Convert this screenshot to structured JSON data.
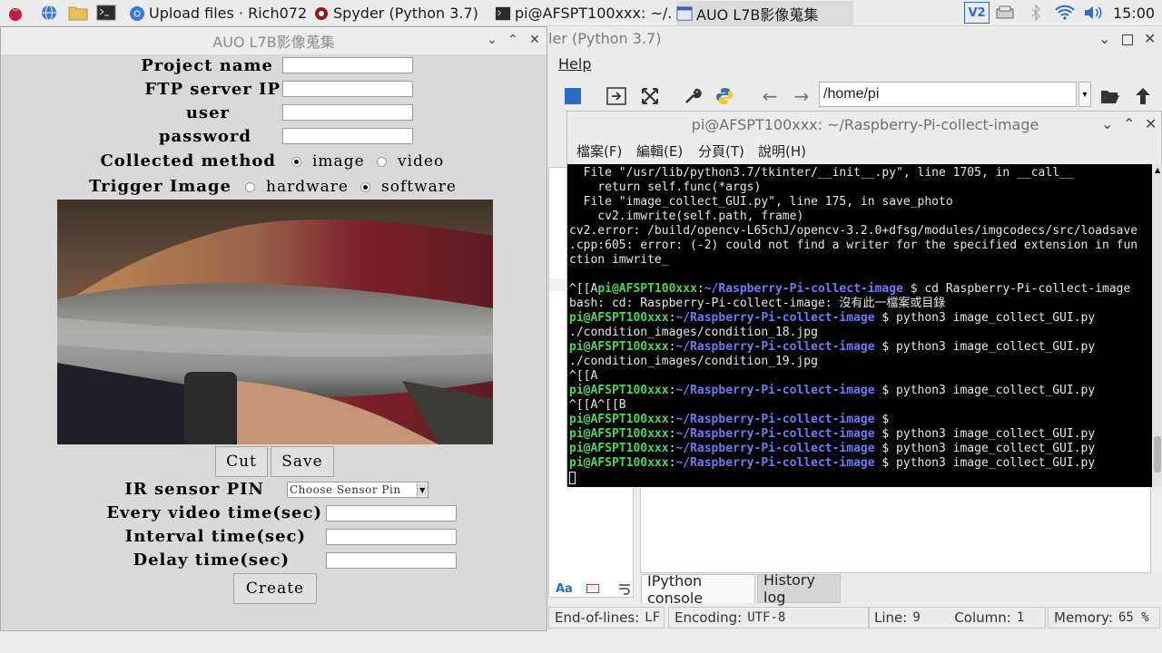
{
  "taskbar": {
    "launchers": [
      "raspberry-menu",
      "web-browser",
      "file-manager",
      "terminal"
    ],
    "tasks": [
      {
        "label": "Upload files · Rich072...",
        "icon": "chromium-icon"
      },
      {
        "label": "Spyder (Python 3.7)",
        "icon": "spyder-icon"
      },
      {
        "label": "pi@AFSPT100xxx: ~/...",
        "icon": "terminal-icon"
      },
      {
        "label": "AUO L7B影像蒐集",
        "icon": "tk-window-icon"
      }
    ],
    "tray_vnc": "V2",
    "clock": "15:00"
  },
  "tk_app": {
    "title": "AUO L7B影像蒐集",
    "project_name_label": "Project name",
    "ftp_label": "FTP server IP",
    "user_label": "user",
    "password_label": "password",
    "collected_label": "Collected method",
    "collected_options": [
      {
        "label": "image",
        "selected": true
      },
      {
        "label": "video",
        "selected": false
      }
    ],
    "trigger_label": "Trigger Image",
    "trigger_options": [
      {
        "label": "hardware",
        "selected": false
      },
      {
        "label": "software",
        "selected": true
      }
    ],
    "cut_button": "Cut",
    "save_button": "Save",
    "ir_label": "IR sensor PIN",
    "ir_select_value": "Choose Sensor Pin",
    "video_time_label": "Every video time(sec)",
    "interval_label": "Interval time(sec)",
    "delay_label": "Delay time(sec)",
    "create_button": "Create"
  },
  "spyder": {
    "title": "ler (Python 3.7)",
    "menu_help": "Help",
    "path_value": "/home/pi",
    "tabs": [
      {
        "label": "IPython console",
        "active": true
      },
      {
        "label": "History log",
        "active": false
      }
    ],
    "status": {
      "eol_label": "End-of-lines:",
      "eol_value": "LF",
      "enc_label": "Encoding:",
      "enc_value": "UTF-8",
      "line_label": "Line:",
      "line_value": "9",
      "col_label": "Column:",
      "col_value": "1",
      "mem_label": "Memory:",
      "mem_value": "65 %"
    }
  },
  "terminal": {
    "title": "pi@AFSPT100xxx: ~/Raspberry-Pi-collect-image",
    "menus": [
      "檔案(F)",
      "編輯(E)",
      "分頁(T)",
      "說明(H)"
    ],
    "prompt_user": "pi@AFSPT100xxx",
    "prompt_path": "~/Raspberry-Pi-collect-image",
    "lines": [
      {
        "text": "  File \"/usr/lib/python3.7/tkinter/__init__.py\", line 1705, in __call__"
      },
      {
        "text": "    return self.func(*args)"
      },
      {
        "text": "  File \"image_collect_GUI.py\", line 175, in save_photo"
      },
      {
        "text": "    cv2.imwrite(self.path, frame)"
      },
      {
        "text": "cv2.error: /build/opencv-L65chJ/opencv-3.2.0+dfsg/modules/imgcodecs/src/loadsave"
      },
      {
        "text": ".cpp:605: error: (-2) could not find a writer for the specified extension in fun"
      },
      {
        "text": "ction imwrite_"
      },
      {
        "text": ""
      },
      {
        "prefix": "^[[A",
        "prompt": true,
        "text": "cd Raspberry-Pi-collect-image"
      },
      {
        "text": "bash: cd: Raspberry-Pi-collect-image: 沒有此一檔案或目錄"
      },
      {
        "prompt": true,
        "text": "python3 image_collect_GUI.py"
      },
      {
        "text": "./condition_images/condition_18.jpg"
      },
      {
        "prompt": true,
        "text": "python3 image_collect_GUI.py"
      },
      {
        "text": "./condition_images/condition_19.jpg"
      },
      {
        "text": "^[[A"
      },
      {
        "prompt": true,
        "text": "python3 image_collect_GUI.py"
      },
      {
        "text": "^[[A^[[B"
      },
      {
        "prompt": true,
        "text": ""
      },
      {
        "prompt": true,
        "text": "python3 image_collect_GUI.py"
      },
      {
        "prompt": true,
        "text": "python3 image_collect_GUI.py"
      },
      {
        "prompt": true,
        "text": "python3 image_collect_GUI.py"
      }
    ]
  }
}
